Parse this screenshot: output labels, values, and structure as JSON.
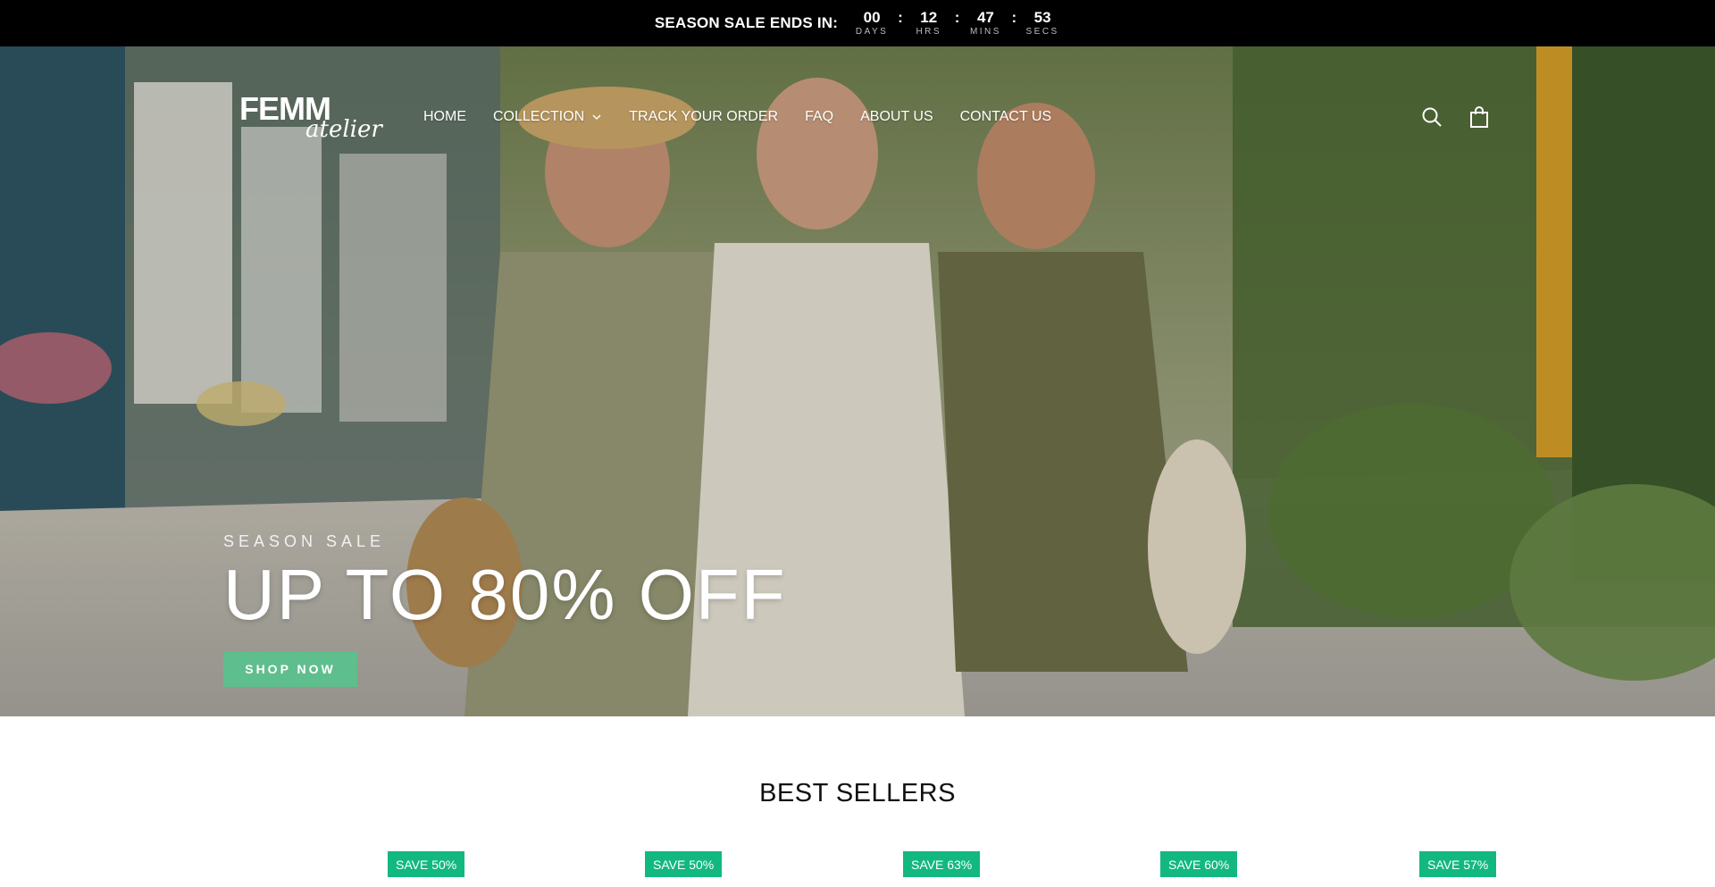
{
  "announcement": {
    "label": "SEASON SALE ENDS IN:",
    "countdown": [
      {
        "value": "00",
        "unit": "DAYS"
      },
      {
        "value": "12",
        "unit": "HRS"
      },
      {
        "value": "47",
        "unit": "MINS"
      },
      {
        "value": "53",
        "unit": "SECS"
      }
    ],
    "separator": ":"
  },
  "header": {
    "logo_line1": "FEMM",
    "logo_line2": "atelier",
    "nav": [
      "HOME",
      "COLLECTION",
      "TRACK YOUR ORDER",
      "FAQ",
      "ABOUT US",
      "CONTACT US"
    ],
    "collection_icon": "chevron-down-icon",
    "search_icon": "search-icon",
    "cart_icon": "shopping-bag-icon"
  },
  "hero": {
    "eyebrow": "SEASON SALE",
    "headline": "UP TO 80% OFF",
    "cta": "SHOP NOW",
    "cta_color": "#5fbe8e"
  },
  "best_sellers": {
    "title": "BEST SELLERS",
    "badges": [
      "SAVE 50%",
      "SAVE 50%",
      "SAVE 63%",
      "SAVE 60%",
      "SAVE 57%"
    ],
    "badge_color": "#12b87f"
  }
}
